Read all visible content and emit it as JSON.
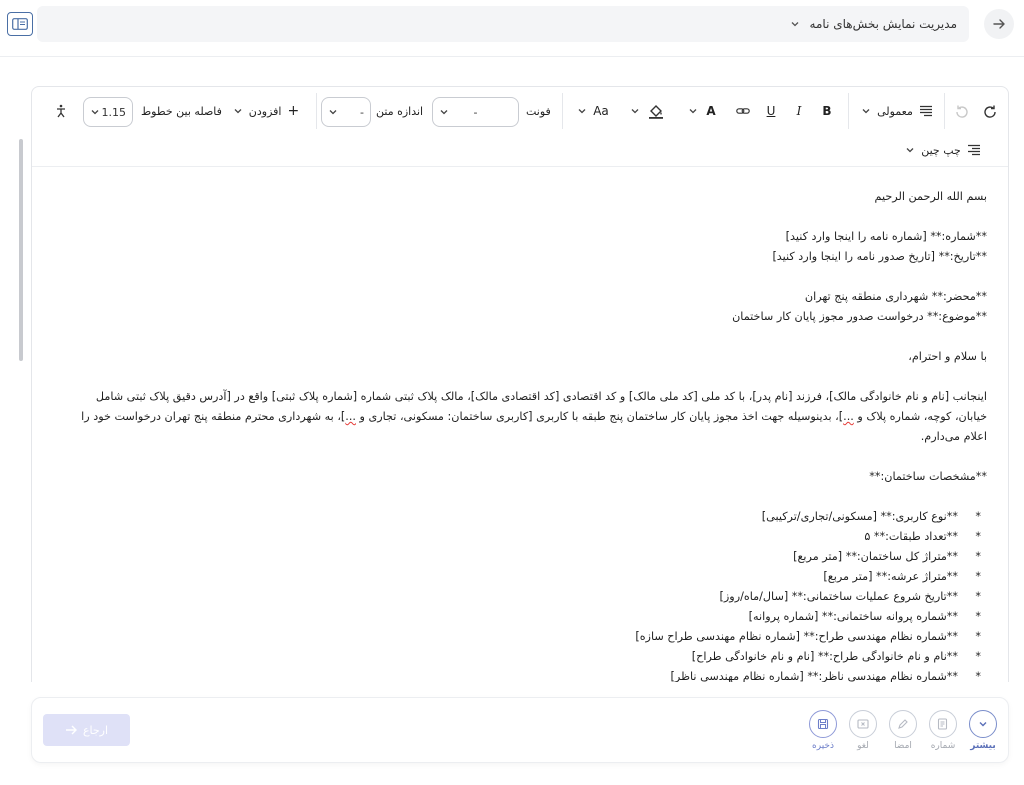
{
  "header": {
    "title": "مدیریت نمایش بخش‌های نامه"
  },
  "toolbar": {
    "style_label": "معمولی",
    "font_label": "فونت",
    "font_value": "-",
    "font_size_label": "اندازه متن",
    "font_size_value": "-",
    "case_label": "Aa",
    "insert_label": "افزودن",
    "line_spacing_label": "فاصله بین خطوط",
    "line_spacing_value": "1.15",
    "align_label": "چپ چین"
  },
  "document": {
    "greeting_bismillah": "بسم الله الرحمن الرحیم",
    "number_line": "**شماره:** [شماره نامه را اینجا وارد کنید]",
    "date_line": "**تاریخ:** [تاریخ صدور نامه را اینجا وارد کنید]",
    "to_line": "**محضر:** شهرداری منطقه پنج تهران",
    "subject_line": "**موضوع:** درخواست صدور مجوز پایان کار ساختمان",
    "salutation": "با سلام و احترام،",
    "body_part1": "اینجانب [نام و نام خانوادگی مالک]، فرزند [نام پدر]، با کد ملی [کد ملی مالک] و کد اقتصادی [کد اقتصادی مالک]، مالک پلاک ثبتی شماره [شماره پلاک ثبتی] واقع در [آدرس دقیق پلاک ثبتی شامل خیابان، کوچه، شماره پلاک و ",
    "body_squig1": "...",
    "body_part2": "]، بدینوسیله جهت اخذ مجوز پایان کار ساختمان پنج طبقه با کاربری [کاربری ساختمان: مسکونی، تجاری و ",
    "body_squig2": "...",
    "body_part3": "]، به شهرداری محترم منطقه پنج تهران درخواست خود را اعلام می‌دارم.",
    "specs_heading": "**مشخصات ساختمان:**",
    "specs": [
      "**نوع کاربری:** [مسکونی/تجاری/ترکیبی]",
      "**تعداد طبقات:** ۵",
      "**متراژ کل ساختمان:** [متر مربع]",
      "**متراژ عرشه:** [متر مربع]",
      "**تاریخ شروع عملیات ساختمانی:** [سال/ماه/روز]",
      "**شماره پروانه ساختمانی:** [شماره پروانه]",
      "**شماره نظام مهندسی طراح:** [شماره نظام مهندسی طراح سازه]",
      "**نام و نام خانوادگی طراح:** [نام و نام خانوادگی طراح]",
      "**شماره نظام مهندسی ناظر:** [شماره نظام مهندسی ناظر]"
    ]
  },
  "actions": {
    "more": "بیشتر",
    "number": "شماره",
    "sign": "امضا",
    "cancel": "لغو",
    "save": "ذخیره",
    "return": "ارجاع"
  },
  "icons": {
    "back": "arrow-right-icon",
    "panel": "panel-toggle-icon",
    "chevron": "chevron-down-icon"
  },
  "colors": {
    "accent": "#5a6fb8",
    "return_button": "#dfe1f7",
    "border": "#e4e6ea"
  }
}
